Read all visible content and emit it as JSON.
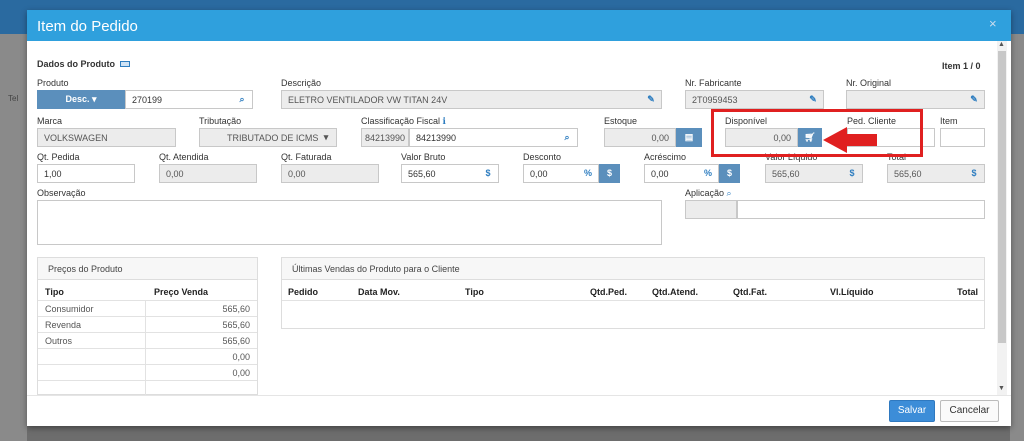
{
  "background": {
    "left_text": "Tel"
  },
  "modal": {
    "title": "Item do Pedido",
    "close": "×"
  },
  "section_title": "Dados do Produto",
  "item_counter": "Item 1 / 0",
  "produto": {
    "label": "Produto",
    "mode": "Desc. ▾",
    "value": "270199"
  },
  "descricao": {
    "label": "Descrição",
    "value": "ELETRO VENTILADOR VW TITAN 24V"
  },
  "nr_fabricante": {
    "label": "Nr. Fabricante",
    "value": "2T0959453"
  },
  "nr_original": {
    "label": "Nr. Original",
    "value": ""
  },
  "marca": {
    "label": "Marca",
    "value": "VOLKSWAGEN"
  },
  "tributacao": {
    "label": "Tributação",
    "value": "TRIBUTADO DE ICMS"
  },
  "classificacao": {
    "label": "Classificação Fiscal",
    "code": "84213990",
    "value": "84213990"
  },
  "estoque": {
    "label": "Estoque",
    "value": "0,00"
  },
  "disponivel": {
    "label": "Disponível",
    "value": "0,00"
  },
  "ped_cliente": {
    "label": "Ped. Cliente",
    "value": ""
  },
  "item": {
    "label": "Item",
    "value": ""
  },
  "qt_pedida": {
    "label": "Qt. Pedida",
    "value": "1,00"
  },
  "qt_atendida": {
    "label": "Qt. Atendida",
    "value": "0,00"
  },
  "qt_faturada": {
    "label": "Qt. Faturada",
    "value": "0,00"
  },
  "valor_bruto": {
    "label": "Valor Bruto",
    "value": "565,60",
    "unit": "$"
  },
  "desconto": {
    "label": "Desconto",
    "value": "0,00",
    "pct": "%",
    "unit": "$"
  },
  "acrescimo": {
    "label": "Acréscimo",
    "value": "0,00",
    "pct": "%",
    "unit": "$"
  },
  "valor_liquido": {
    "label": "Valor Líquido",
    "value": "565,60",
    "unit": "$"
  },
  "total": {
    "label": "Total",
    "value": "565,60",
    "unit": "$"
  },
  "observacao": {
    "label": "Observação",
    "value": ""
  },
  "aplicacao": {
    "label": "Aplicação",
    "value": ""
  },
  "precos": {
    "title": "Preços do Produto",
    "headers": [
      "Tipo",
      "Preço Venda"
    ],
    "rows": [
      [
        "Consumidor",
        "565,60"
      ],
      [
        "Revenda",
        "565,60"
      ],
      [
        "Outros",
        "565,60"
      ],
      [
        "",
        "0,00"
      ],
      [
        "",
        "0,00"
      ]
    ]
  },
  "ultimas": {
    "title": "Últimas Vendas do Produto para o Cliente",
    "headers": [
      "Pedido",
      "Data Mov.",
      "Tipo",
      "Qtd.Ped.",
      "Qtd.Atend.",
      "Qtd.Fat.",
      "Vl.Líquido",
      "Total"
    ]
  },
  "buttons": {
    "save": "Salvar",
    "cancel": "Cancelar"
  },
  "colors": {
    "header": "#2fa0dd",
    "accent_button": "#5b8fbc",
    "highlight": "#e02020"
  }
}
